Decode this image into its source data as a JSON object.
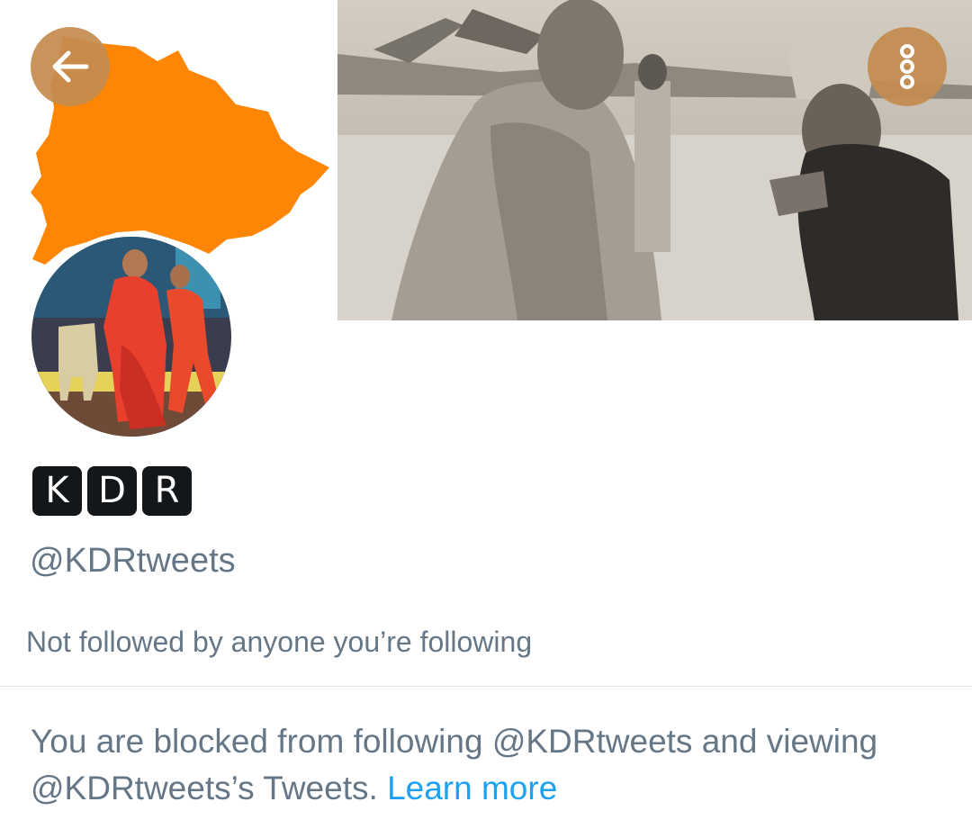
{
  "header": {
    "back_icon": "arrow-left-icon",
    "more_icon": "vertical-dots-icon",
    "button_color": "#c48c50"
  },
  "banner": {
    "map_color": "#ff8605"
  },
  "profile": {
    "name_letters": [
      "K",
      "D",
      "R"
    ],
    "handle": "@KDRtweets",
    "followed_by": "Not followed by anyone you’re following"
  },
  "blocked_notice": {
    "text": "You are blocked from following @KDRtweets and viewing @KDRtweets’s Tweets. ",
    "link": "Learn more",
    "link_color": "#1da1f2"
  }
}
